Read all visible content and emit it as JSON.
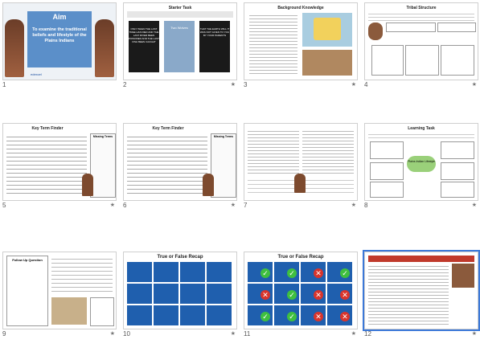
{
  "slides": [
    {
      "number": "1",
      "title": "Aim",
      "subtitle": "To examine the traditional beliefs and lifestyle of the Plains Indians",
      "footer": "edexcel"
    },
    {
      "number": "2",
      "title": "Starter Task",
      "quote1": "ONLY WHEN THE LAST TREE HAS DIED AND THE LAST RIVER BEEN POISONED AND THE LAST FISH BEEN CAUGHT",
      "quote2": "THAT THE EARTH WILL IT WAS NOT GIVEN TO YOU BY YOUR PARENTS",
      "quote3": "Two Wolves",
      "star": "★"
    },
    {
      "number": "3",
      "title": "Background Knowledge",
      "star": "★"
    },
    {
      "number": "4",
      "title": "Tribal Structure",
      "star": "★"
    },
    {
      "number": "5",
      "title": "Key Term Finder",
      "side": "Missing Terms",
      "star": "★"
    },
    {
      "number": "6",
      "title": "Key Term Finder",
      "side": "Missing Terms",
      "star": "★"
    },
    {
      "number": "7",
      "title": "",
      "star": "★"
    },
    {
      "number": "8",
      "title": "Learning Task",
      "center": "Plains Indian Lifestyle",
      "star": "★"
    },
    {
      "number": "9",
      "title": "Follow Up Question",
      "star": "★"
    },
    {
      "number": "10",
      "title": "True or False Recap",
      "star": "★"
    },
    {
      "number": "11",
      "title": "True or False Recap",
      "star": "★"
    },
    {
      "number": "12",
      "title": "",
      "star": "★"
    }
  ],
  "colors": {
    "accent": "#3b78d8",
    "aim_bg": "#5b8fc9",
    "tf_blue": "#1f5fae",
    "check": "#3fbf3f",
    "cross": "#d9342b"
  }
}
